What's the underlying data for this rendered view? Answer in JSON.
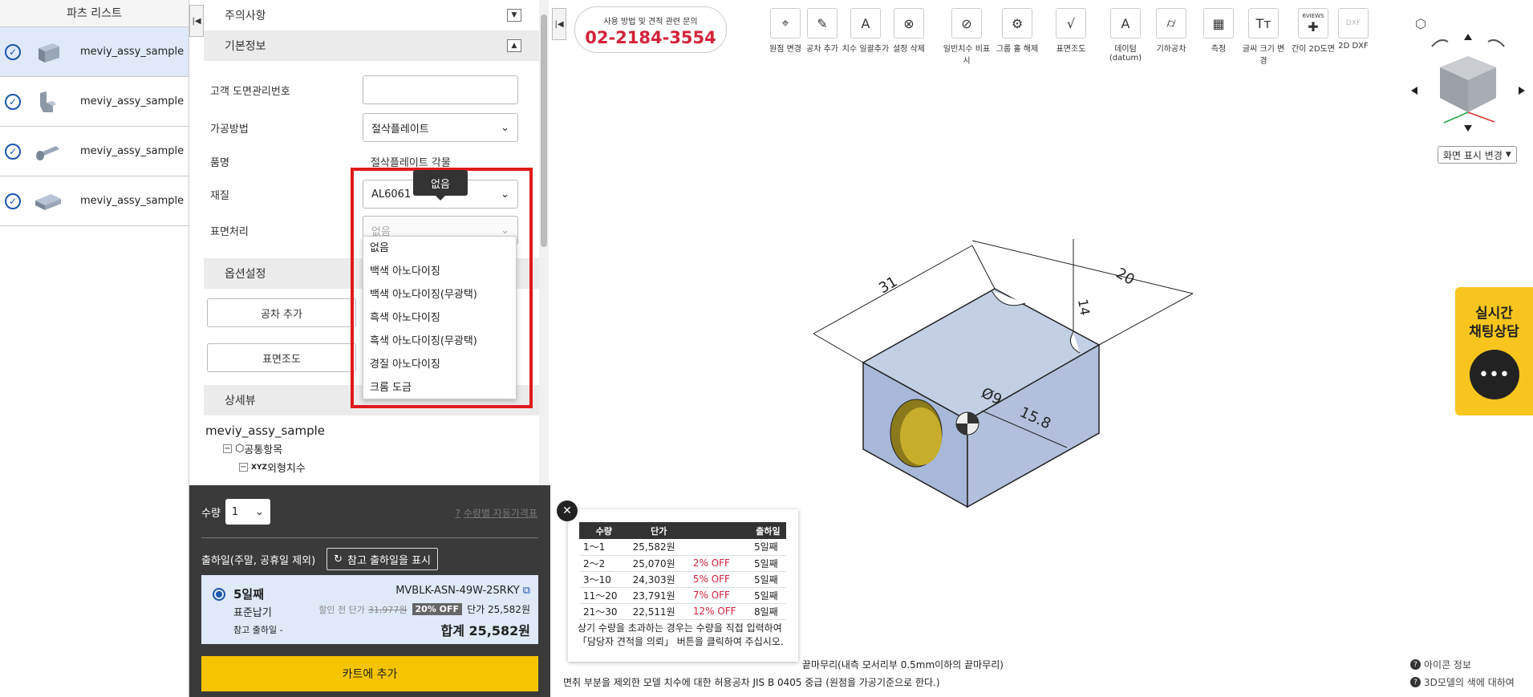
{
  "parts_list": {
    "header": "파츠 리스트",
    "items": [
      {
        "label": "meviy_assy_sample",
        "selected": true
      },
      {
        "label": "meviy_assy_sample",
        "selected": false
      },
      {
        "label": "meviy_assy_sample",
        "selected": false
      },
      {
        "label": "meviy_assy_sample",
        "selected": false
      }
    ]
  },
  "form": {
    "notice_header": "주의사항",
    "basic_header": "기본정보",
    "fields": {
      "drawing_no_label": "고객 도면관리번호",
      "drawing_no_value": "",
      "method_label": "가공방법",
      "method_value": "절삭플레이트",
      "product_label": "품명",
      "product_value": "절삭플레이트 각물",
      "material_label": "재질",
      "material_value": "AL6061",
      "surface_label": "표면처리",
      "surface_value": "없음"
    },
    "tooltip": "없음",
    "surface_options": [
      "없음",
      "백색 아노다이징",
      "백색 아노다이징(무광택)",
      "흑색 아노다이징",
      "흑색 아노다이징(무광택)",
      "경질 아노다이징",
      "크롬 도금"
    ],
    "options_header": "옵션설정",
    "options": {
      "tolerance_btn": "공차 추가",
      "roughness_btn": "표면조도"
    },
    "detail_header": "상세뷰",
    "tree": {
      "root": "meviy_assy_sample",
      "common": "공통항목",
      "outer": "외형치수"
    }
  },
  "quote": {
    "qty_label": "수량",
    "qty_value": "1",
    "auto_price_link": "수량별 자동가격표",
    "ship_label": "출하일(주말, 공휴일 제외)",
    "ref_ship_btn": "참고 출하일을 표시",
    "ship_days": "5일째",
    "ship_type": "표준납기",
    "ref_ship_date": "참고 출하일 -",
    "part_code": "MVBLK-ASN-49W-2SRKY",
    "list_price_label": "할인 전 단가",
    "list_price": "31,977원",
    "discount_badge": "20% OFF",
    "unit_price": "단가 25,582원",
    "total": "합계 25,582원",
    "cart_btn": "카트에 추가"
  },
  "viewer": {
    "phone_caption": "사용 방법 및 견적 관련 문의",
    "phone_number": "02-2184-3554",
    "toolbar": [
      {
        "icon": "origin-change-icon",
        "label": "원점 변경"
      },
      {
        "icon": "tolerance-add-icon",
        "label": "공차 추가"
      },
      {
        "icon": "dimension-batch-icon",
        "label": "치수 일괄추가"
      },
      {
        "icon": "delete-setting-icon",
        "label": "설정 삭제"
      },
      {
        "icon": "hide-dimension-icon",
        "label": "일반치수 비표시"
      },
      {
        "icon": "ungroup-icon",
        "label": "그룹 홀 해제"
      },
      {
        "icon": "surface-roughness-icon",
        "label": "표면조도"
      },
      {
        "icon": "datum-icon",
        "label": "데이텀 (datum)"
      },
      {
        "icon": "geometric-tolerance-icon",
        "label": "기하공차"
      },
      {
        "icon": "measure-icon",
        "label": "측정"
      },
      {
        "icon": "font-size-icon",
        "label": "글씨 크기 변경"
      },
      {
        "icon": "simple-2d-icon",
        "label": "간이 2D도면",
        "badge": "6VIEWS"
      },
      {
        "icon": "dxf-icon",
        "label": "2D DXF",
        "badge": "DXF"
      }
    ],
    "view_change_btn": "화면 표시 변경",
    "dimensions": {
      "d1": "31",
      "d2": "20",
      "d3": "14",
      "hole": "Ø9",
      "depth": "15.8"
    },
    "chat": {
      "line1": "실시간",
      "line2": "채팅상담"
    },
    "price_table": {
      "headers": [
        "수량",
        "단가",
        "",
        "출하일"
      ],
      "rows": [
        [
          "1～1",
          "25,582원",
          "",
          "5일째"
        ],
        [
          "2～2",
          "25,070원",
          "2% OFF",
          "5일째"
        ],
        [
          "3～10",
          "24,303원",
          "5% OFF",
          "5일째"
        ],
        [
          "11～20",
          "23,791원",
          "7% OFF",
          "5일째"
        ],
        [
          "21～30",
          "22,511원",
          "12% OFF",
          "8일째"
        ]
      ],
      "note": "상기 수량을 초과하는 경우는 수량을 직접 입력하여 「담당자 견적을 의뢰」 버튼을 클릭하여 주십시오."
    },
    "footer_line1": "끝마무리(내측 모서리부 0.5mm이하의 끝마무리)",
    "footer_line2": "면취 부분을 제외한 모델 치수에 대한 허용공차 JIS B 0405 중급 (원점을 가공기준으로 한다.)",
    "icon_info": "아이콘 정보",
    "color_info": "3D모델의 색에 대하여"
  }
}
